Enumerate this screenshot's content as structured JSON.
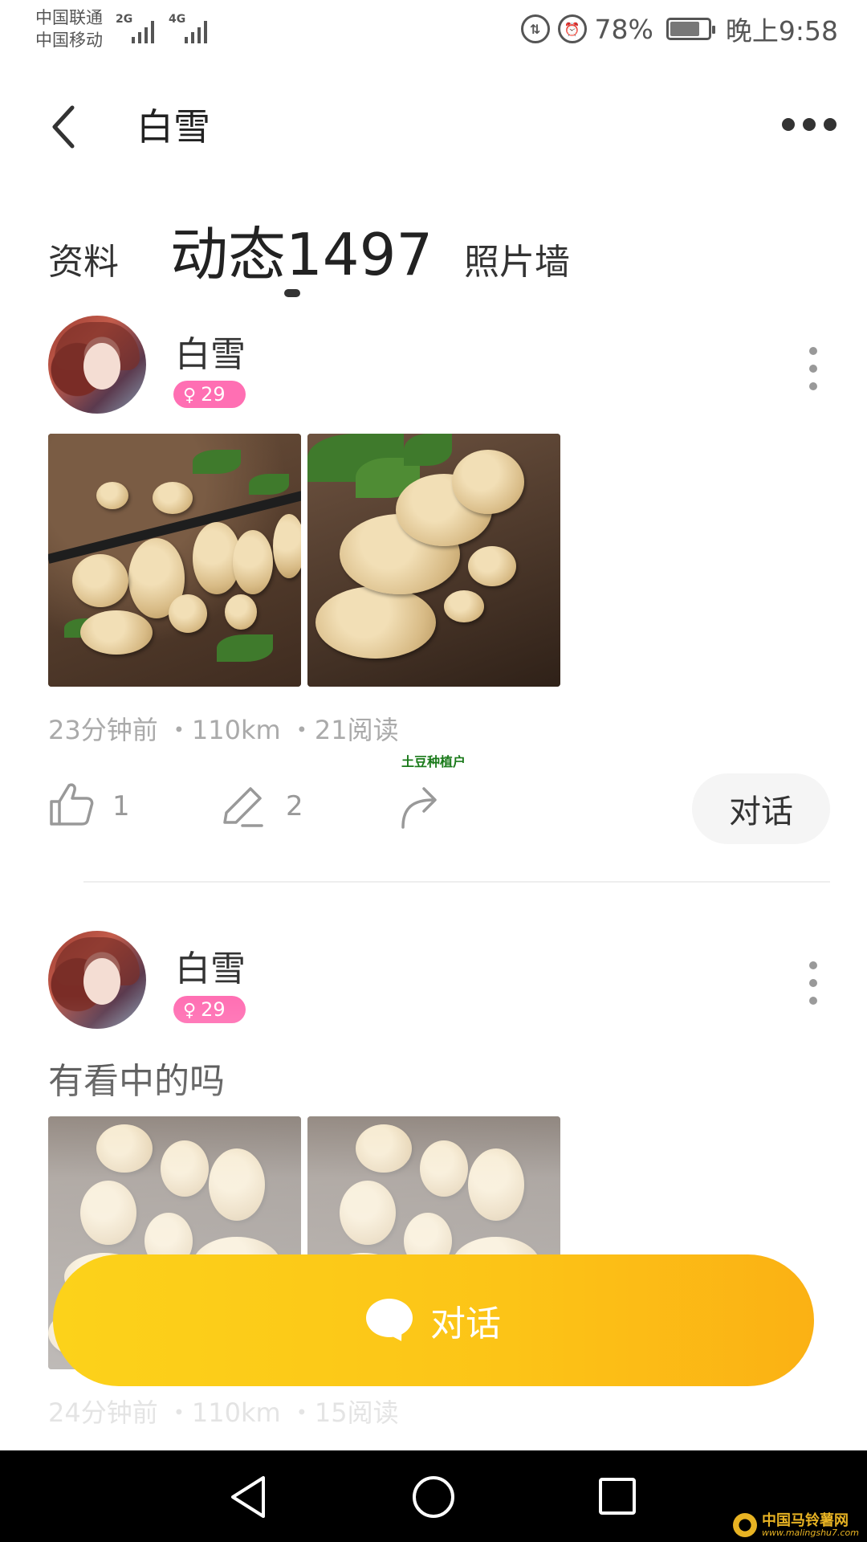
{
  "status_bar": {
    "carrier1": "中国联通",
    "carrier2": "中国移动",
    "net1": "2G",
    "net2": "4G",
    "battery_percent": "78%",
    "battery_level": 0.78,
    "time": "晚上9:58",
    "icons": [
      "data-saver-icon",
      "alarm-icon",
      "battery-icon"
    ]
  },
  "header": {
    "title": "白雪"
  },
  "tabs": [
    {
      "label": "资料"
    },
    {
      "label": "动态1497",
      "active": true
    },
    {
      "label": "照片墙"
    }
  ],
  "posts": [
    {
      "username": "白雪",
      "badge_age": "29",
      "meta": "23分钟前 ・110km ・21阅读",
      "like_count": "1",
      "comment_count": "2",
      "chat_label": "对话"
    },
    {
      "username": "白雪",
      "badge_age": "29",
      "text": "有看中的吗",
      "meta": "24分钟前 ・110km ・15阅读"
    }
  ],
  "overlay_label": "土豆种植户",
  "floating_chat": {
    "label": "对话"
  },
  "watermark": {
    "name": "中国马铃薯网",
    "url": "www.malingshu7.com"
  },
  "colors": {
    "badge": "#ff6fb3",
    "float_button": "#fcc417",
    "accent_text": "#333333"
  }
}
